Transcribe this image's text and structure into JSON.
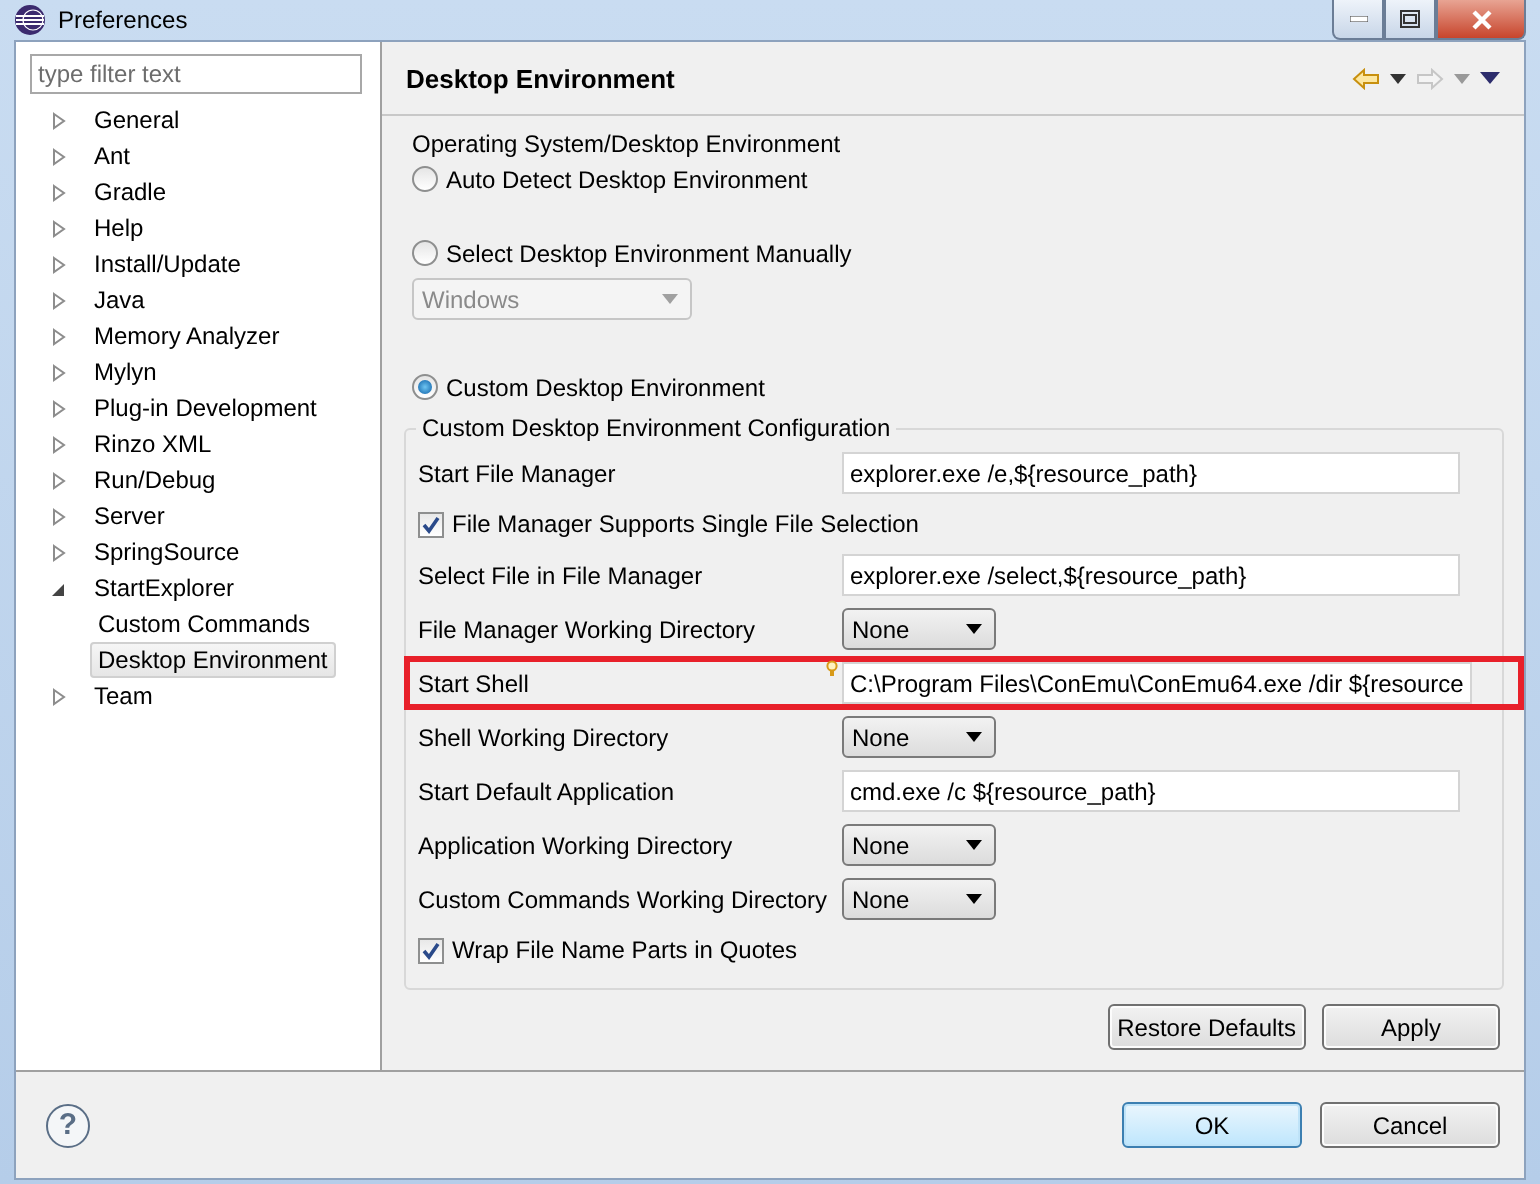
{
  "window": {
    "title": "Preferences"
  },
  "filter": {
    "placeholder": "type filter text"
  },
  "tree": [
    {
      "label": "General",
      "expanded": false,
      "selected": false
    },
    {
      "label": "Ant",
      "expanded": false,
      "selected": false
    },
    {
      "label": "Gradle",
      "expanded": false,
      "selected": false
    },
    {
      "label": "Help",
      "expanded": false,
      "selected": false
    },
    {
      "label": "Install/Update",
      "expanded": false,
      "selected": false
    },
    {
      "label": "Java",
      "expanded": false,
      "selected": false
    },
    {
      "label": "Memory Analyzer",
      "expanded": false,
      "selected": false
    },
    {
      "label": "Mylyn",
      "expanded": false,
      "selected": false
    },
    {
      "label": "Plug-in Development",
      "expanded": false,
      "selected": false
    },
    {
      "label": "Rinzo XML",
      "expanded": false,
      "selected": false
    },
    {
      "label": "Run/Debug",
      "expanded": false,
      "selected": false
    },
    {
      "label": "Server",
      "expanded": false,
      "selected": false
    },
    {
      "label": "SpringSource",
      "expanded": false,
      "selected": false
    },
    {
      "label": "StartExplorer",
      "expanded": true,
      "selected": false,
      "children": [
        {
          "label": "Custom Commands",
          "selected": false
        },
        {
          "label": "Desktop Environment",
          "selected": true
        }
      ]
    },
    {
      "label": "Team",
      "expanded": false,
      "selected": false
    }
  ],
  "page": {
    "title": "Desktop Environment"
  },
  "os_group": {
    "label": "Operating System/Desktop Environment"
  },
  "options": [
    {
      "label": "Auto Detect Desktop Environment",
      "selected": false
    },
    {
      "label": "Select Desktop Environment Manually",
      "selected": false,
      "combo": {
        "value": "Windows",
        "disabled": true
      }
    },
    {
      "label": "Custom Desktop Environment",
      "selected": true
    }
  ],
  "config": {
    "title": "Custom Desktop Environment Configuration",
    "rows": [
      {
        "kind": "text",
        "label": "Start File Manager",
        "value": "explorer.exe /e,${resource_path}",
        "highlighted": false
      },
      {
        "kind": "checkbox",
        "label": "File Manager Supports Single File Selection",
        "checked": true
      },
      {
        "kind": "text",
        "label": "Select File in File Manager",
        "value": "explorer.exe /select,${resource_path}",
        "highlighted": false
      },
      {
        "kind": "combo",
        "label": "File Manager Working Directory",
        "value": "None"
      },
      {
        "kind": "text",
        "label": "Start Shell",
        "value": "C:\\Program Files\\ConEmu\\ConEmu64.exe /dir ${resource",
        "highlighted": true
      },
      {
        "kind": "combo",
        "label": "Shell Working Directory",
        "value": "None"
      },
      {
        "kind": "text",
        "label": "Start Default Application",
        "value": "cmd.exe /c ${resource_path}",
        "highlighted": false
      },
      {
        "kind": "combo",
        "label": "Application Working Directory",
        "value": "None"
      },
      {
        "kind": "combo",
        "label": "Custom Commands Working Directory",
        "value": "None"
      },
      {
        "kind": "checkbox",
        "label": "Wrap File Name Parts in Quotes",
        "checked": true
      }
    ]
  },
  "page_buttons": [
    "Restore Defaults",
    "Apply"
  ],
  "help": {
    "glyph": "?"
  },
  "dialog_buttons": [
    {
      "label": "OK",
      "default": true
    },
    {
      "label": "Cancel",
      "default": false
    }
  ]
}
